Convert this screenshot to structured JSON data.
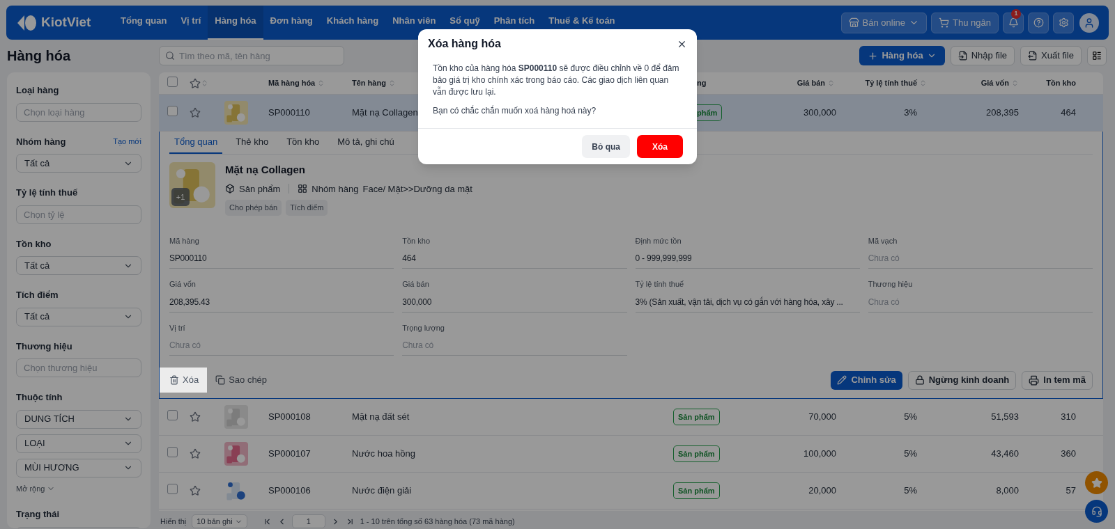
{
  "nav": {
    "logo": "KiotViet",
    "items": [
      {
        "label": "Tổng quan",
        "selected": false
      },
      {
        "label": "Vị trí",
        "selected": false
      },
      {
        "label": "Hàng hóa",
        "selected": true
      },
      {
        "label": "Đơn hàng",
        "selected": false
      },
      {
        "label": "Khách hàng",
        "selected": false
      },
      {
        "label": "Nhân viên",
        "selected": false
      },
      {
        "label": "Sổ quỹ",
        "selected": false
      },
      {
        "label": "Phân tích",
        "selected": false
      },
      {
        "label": "Thuế & Kế toán",
        "selected": false
      }
    ],
    "online_button": "Bán online",
    "cashier_button": "Thu ngân",
    "notification_count": "1"
  },
  "page_title": "Hàng hóa",
  "search": {
    "placeholder": "Tìm theo mã, tên hàng"
  },
  "toolbar": {
    "add_button": "Hàng hóa",
    "import_button": "Nhập file",
    "export_button": "Xuất file"
  },
  "sidebar": {
    "filters": [
      {
        "label": "Loại hàng",
        "fields": [
          {
            "kind": "input",
            "placeholder": "Chọn loại hàng"
          }
        ]
      },
      {
        "label": "Nhóm hàng",
        "link": "Tạo mới",
        "fields": [
          {
            "kind": "select",
            "value": "Tất cả"
          }
        ]
      },
      {
        "label": "Tỷ lệ tính thuế",
        "fields": [
          {
            "kind": "input",
            "placeholder": "Chọn tỷ lệ"
          }
        ]
      },
      {
        "label": "Tồn kho",
        "fields": [
          {
            "kind": "select",
            "value": "Tất cả"
          }
        ]
      },
      {
        "label": "Tích điểm",
        "fields": [
          {
            "kind": "select",
            "value": "Tất cả"
          }
        ]
      },
      {
        "label": "Thương hiệu",
        "fields": [
          {
            "kind": "input",
            "placeholder": "Chọn thương hiệu"
          }
        ]
      },
      {
        "label": "Thuộc tính",
        "fields": [
          {
            "kind": "select",
            "value": "DUNG TÍCH"
          },
          {
            "kind": "select",
            "value": "LOẠI"
          },
          {
            "kind": "select",
            "value": "MÙI HƯƠNG"
          }
        ],
        "more": "Mở rộng"
      },
      {
        "label": "Trạng thái",
        "fields": [
          {
            "kind": "input"
          }
        ]
      }
    ]
  },
  "table": {
    "select_all_checked": false,
    "columns": [
      {
        "label": "Mã hàng hóa",
        "sortable": true
      },
      {
        "label": "Tên hàng",
        "sortable": true
      },
      {
        "label": "ng",
        "sortable": false
      },
      {
        "label": "Giá bán",
        "sortable": true
      },
      {
        "label": "Tỷ lệ tính thuế",
        "sortable": true
      },
      {
        "label": "Giá vốn",
        "sortable": true
      },
      {
        "label": "Tồn kho",
        "sortable": false
      }
    ],
    "rows": [
      {
        "selected": true,
        "checked": false,
        "starred": false,
        "code": "SP000110",
        "name": "Mặt nạ Collagen",
        "type": "phẩm",
        "price": "300,000",
        "tax": "3%",
        "cost": "208,395",
        "stock": "464",
        "detail": {
          "tabs": [
            {
              "label": "Tổng quan",
              "selected": true
            },
            {
              "label": "Thẻ kho",
              "selected": false
            },
            {
              "label": "Tồn kho",
              "selected": false
            },
            {
              "label": "Mô tả, ghi chú",
              "selected": false
            }
          ],
          "image_count": "+1",
          "name": "Mặt nạ Collagen",
          "product_kind": "Sản phẩm",
          "group_label": "Nhóm hàng",
          "group": "Face/ Mặt>>Dưỡng da mặt",
          "tags": [
            "Cho phép bán",
            "Tích điểm"
          ],
          "fields": [
            {
              "label": "Mã hàng",
              "value": "SP000110"
            },
            {
              "label": "Tồn kho",
              "value": "464"
            },
            {
              "label": "Định mức tồn",
              "value": "0 - 999,999,999"
            },
            {
              "label": "Mã vạch",
              "placeholder": "Chưa có"
            },
            {
              "label": "Giá vốn",
              "value": "208,395.43"
            },
            {
              "label": "Giá bán",
              "value": "300,000"
            },
            {
              "label": "Tỷ lệ tính thuế",
              "value": "3% (Sản xuất, vận tải, dịch vụ có gắn với hàng hóa, xây ..."
            },
            {
              "label": "Thương hiệu",
              "placeholder": "Chưa có"
            },
            {
              "label": "Vị trí",
              "placeholder": "Chưa có"
            },
            {
              "label": "Trọng lượng",
              "placeholder": "Chưa có"
            }
          ],
          "left_actions": [
            {
              "kind": "delete",
              "label": "Xóa",
              "highlighted": true
            },
            {
              "kind": "copy",
              "label": "Sao chép",
              "highlighted": false
            }
          ],
          "right_actions": [
            {
              "kind": "edit",
              "label": "Chỉnh sửa",
              "primary": true
            },
            {
              "kind": "lock",
              "label": "Ngừng kinh doanh",
              "primary": false
            },
            {
              "kind": "print",
              "label": "In tem mã",
              "primary": false
            }
          ]
        }
      },
      {
        "selected": false,
        "checked": false,
        "starred": false,
        "code": "SP000108",
        "name": "Mặt nạ đất sét",
        "type": "Sản phẩm",
        "price": "70,000",
        "tax": "5%",
        "cost": "51,593",
        "stock": "310"
      },
      {
        "selected": false,
        "checked": false,
        "starred": false,
        "code": "SP000107",
        "name": "Nước hoa hồng",
        "type": "Sản phẩm",
        "price": "100,000",
        "tax": "5%",
        "cost": "43,460",
        "stock": "360"
      },
      {
        "selected": false,
        "checked": false,
        "starred": false,
        "code": "SP000106",
        "name": "Nước điện giải",
        "type": "Sản phẩm",
        "price": "20,000",
        "tax": "5%",
        "cost": "8,000",
        "stock": "57"
      }
    ]
  },
  "footer": {
    "show_label": "Hiển thị",
    "page_size": "10 bản ghi",
    "page": "1",
    "summary": "1 - 10 trên tổng số 63 hàng hóa (73 mã hàng)"
  },
  "modal": {
    "title": "Xóa hàng hóa",
    "message": "Tồn kho của hàng hóa **SP000110** sẽ được điều chỉnh về 0 để đảm bảo giá trị kho chính xác trong báo cáo. Các giao dịch liên quan vẫn được lưu lại.",
    "question": "Bạn có chắc chắn muốn xoá hàng hoá này?",
    "cancel_button": "Bỏ qua",
    "confirm_button": "Xóa"
  }
}
